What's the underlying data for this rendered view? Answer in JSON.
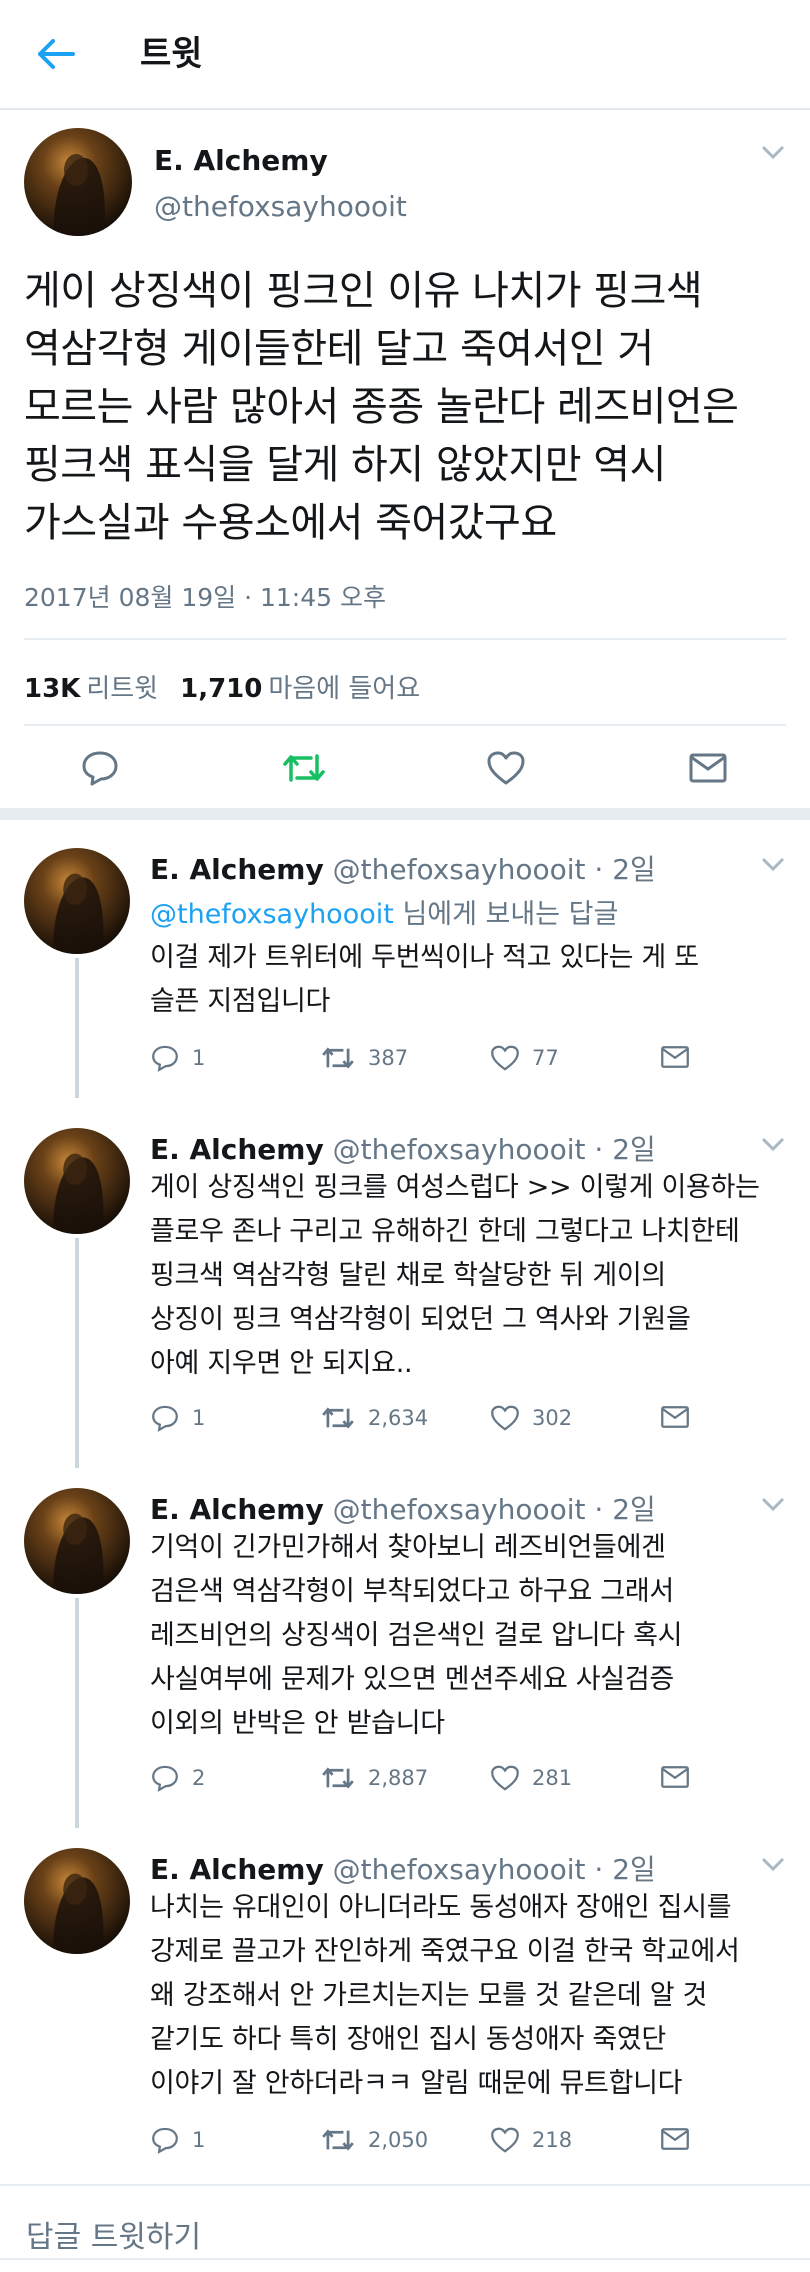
{
  "header": {
    "title": "트윗",
    "back_icon": "arrow-left-icon"
  },
  "colors": {
    "accent": "#1da1f2",
    "retweet_green": "#17bf63",
    "muted": "#657786"
  },
  "main_tweet": {
    "name": "E. Alchemy",
    "handle": "@thefoxsayhoooit",
    "lines": [
      "게이 상징색이 핑크인 이유 나치가 핑크색",
      "역삼각형 게이들한테 달고 죽여서인 거",
      "모르는 사람 많아서 종종 놀란다 레즈비언은",
      "핑크색 표식을 달게 하지 않았지만 역시",
      "가스실과 수용소에서 죽어갔구요"
    ],
    "time": "2017년 08월 19일 · 11:45 오후",
    "retweets": "13K",
    "retweets_label": "리트윗",
    "likes": "1,710",
    "likes_label": "마음에 들어요"
  },
  "replies": [
    {
      "name": "E. Alchemy",
      "handle": "@thefoxsayhoooit",
      "date": "· 2일",
      "reply_to_handle": "@thefoxsayhoooit",
      "reply_to_suffix": "님에게 보내는 답글",
      "lines": [
        "이걸 제가 트위터에 두번씩이나 적고 있다는 게 또",
        "슬픈 지점입니다"
      ],
      "replies": "1",
      "retweets": "387",
      "likes": "77"
    },
    {
      "name": "E. Alchemy",
      "handle": "@thefoxsayhoooit",
      "date": "· 2일",
      "lines": [
        "게이 상징색인 핑크를 여성스럽다 >> 이렇게 이용하는",
        "플로우 존나 구리고 유해하긴 한데 그렇다고 나치한테",
        "핑크색 역삼각형 달린 채로 학살당한 뒤 게이의",
        "상징이 핑크 역삼각형이 되었던 그 역사와 기원을",
        "아예 지우면 안 되지요.."
      ],
      "replies": "1",
      "retweets": "2,634",
      "likes": "302"
    },
    {
      "name": "E. Alchemy",
      "handle": "@thefoxsayhoooit",
      "date": "· 2일",
      "lines": [
        "기억이 긴가민가해서 찾아보니 레즈비언들에겐",
        "검은색 역삼각형이 부착되었다고 하구요 그래서",
        "레즈비언의 상징색이 검은색인 걸로 압니다 혹시",
        "사실여부에 문제가 있으면 멘션주세요 사실검증",
        "이외의 반박은 안 받습니다"
      ],
      "replies": "2",
      "retweets": "2,887",
      "likes": "281"
    },
    {
      "name": "E. Alchemy",
      "handle": "@thefoxsayhoooit",
      "date": "· 2일",
      "lines": [
        "나치는 유대인이 아니더라도 동성애자 장애인 집시를",
        "강제로 끌고가 잔인하게 죽였구요 이걸 한국 학교에서",
        "왜 강조해서 안 가르치는지는 모를 것 같은데 알 것",
        "같기도 하다 특히 장애인 집시 동성애자 죽였단",
        "이야기 잘 안하더라ㅋㅋ 알림 때문에 뮤트합니다"
      ],
      "replies": "1",
      "retweets": "2,050",
      "likes": "218"
    }
  ],
  "footer": {
    "reply_placeholder": "답글 트윗하기"
  }
}
